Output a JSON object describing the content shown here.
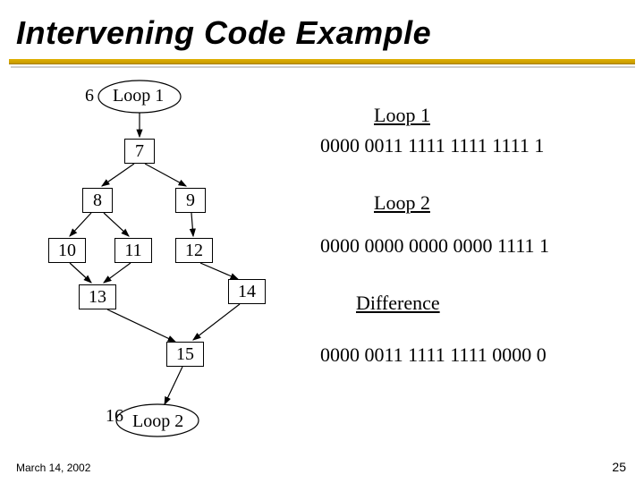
{
  "title": "Intervening Code Example",
  "diagram": {
    "loop1_label": "Loop 1",
    "loop2_label": "Loop 2",
    "nodes": {
      "n6": "6",
      "n7": "7",
      "n8": "8",
      "n9": "9",
      "n10": "10",
      "n11": "11",
      "n12": "12",
      "n13": "13",
      "n14": "14",
      "n15": "15",
      "n16": "16"
    }
  },
  "right": {
    "loop1_heading": "Loop 1",
    "loop1_bits": "0000 0011 1111 1111 1111 1",
    "loop2_heading": "Loop 2",
    "loop2_bits": "0000 0000 0000 0000 1111 1",
    "diff_heading": "Difference",
    "diff_bits": "0000 0011 1111 1111 0000 0"
  },
  "footer": {
    "date": "March 14, 2002",
    "page": "25"
  }
}
